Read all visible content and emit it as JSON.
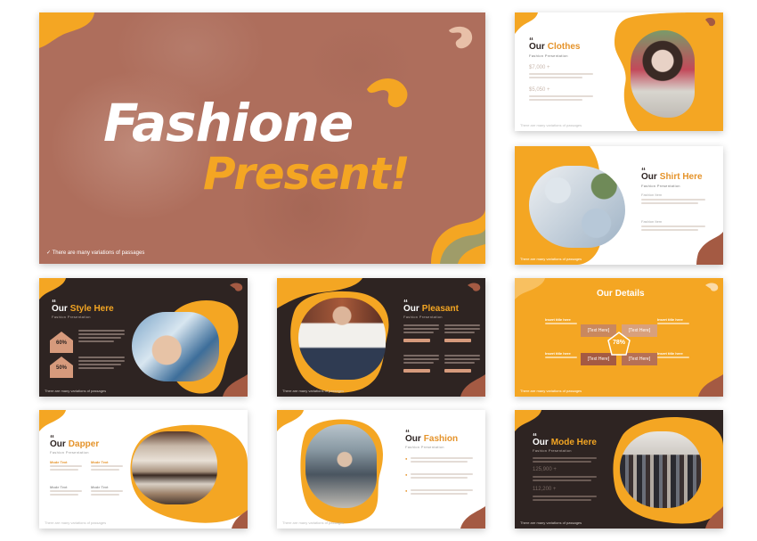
{
  "colors": {
    "orange": "#F4A623",
    "brown": "#A45A43",
    "dark": "#2E2422",
    "cover_bg": "#B07060",
    "light_text": "#ffffff"
  },
  "cover": {
    "title_line1": "Fashione",
    "title_line2": "Present!",
    "footer": "There are many variations of passages",
    "check_icon": "check-icon"
  },
  "slides": {
    "clothes": {
      "quote": "“",
      "title_word1": "Our",
      "title_word2": "Clothes",
      "subtitle": "Fashion Presentation",
      "stat1": "$7,000 +",
      "stat2": "$5,050 +"
    },
    "shirt": {
      "quote": "“",
      "title_word1": "Our",
      "title_word2": "Shirt Here",
      "subtitle": "Fashion Presentation",
      "label1": "Fashion Item",
      "label2": "Fashion Item"
    },
    "style": {
      "quote": "“",
      "title_word1": "Our",
      "title_word2": "Style Here",
      "subtitle": "Fashion Presentation",
      "stat1": "60%",
      "stat2": "50%"
    },
    "pleasant": {
      "quote": "“",
      "title_word1": "Our",
      "title_word2": "Pleasant",
      "subtitle": "Fashion Presentation"
    },
    "details": {
      "title_word1": "Our",
      "title_word2": "Details",
      "center_value": "78%",
      "box_label": "[Text Here]",
      "heading1": "Insert title here",
      "heading2": "Insert title here",
      "heading3": "Insert title here",
      "heading4": "Insert title here"
    },
    "dapper": {
      "quote": "“",
      "title_word1": "Our",
      "title_word2": "Dapper",
      "subtitle": "Fashion Presentation",
      "col1": "Mode Text",
      "col2": "Mode Text",
      "col3": "Mode Text",
      "col4": "Mode Text"
    },
    "fashion": {
      "quote": "“",
      "title_word1": "Our",
      "title_word2": "Fashion",
      "subtitle": "Fashion Presentation"
    },
    "mode": {
      "quote": "“",
      "title_word1": "Our",
      "title_word2": "Mode Here",
      "subtitle": "Fashion Presentation",
      "stat1": "125,900 +",
      "stat2": "112,200 +"
    }
  },
  "small_footer": "There are many variations of passages"
}
